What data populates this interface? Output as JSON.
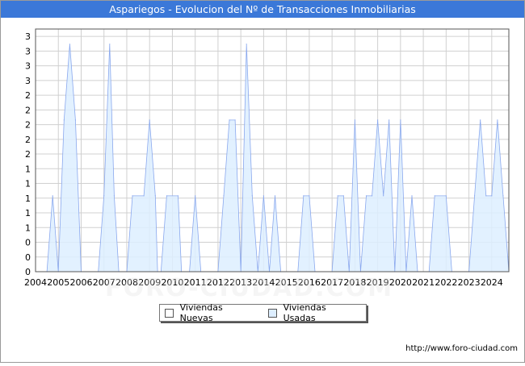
{
  "title": "Aspariegos - Evolucion del Nº de Transacciones Inmobiliarias",
  "url": "http://www.foro-ciudad.com",
  "watermark": "FORO-CIUDAD.COM",
  "legend": {
    "nuevas": "Viviendas Nuevas",
    "usadas": "Viviendas Usadas"
  },
  "colors": {
    "title_bg": "#3b78d8",
    "area_fill": "#ddeeff",
    "area_line": "#8aa8ee",
    "grid": "#d0d0d0"
  },
  "chart_data": {
    "type": "area",
    "title": "Aspariegos - Evolucion del Nº de Transacciones Inmobiliarias",
    "xlabel": "",
    "ylabel": "",
    "xlim": [
      2004,
      2024.75
    ],
    "ylim": [
      0,
      3.2
    ],
    "x_ticks": [
      "2004",
      "2005",
      "2006",
      "2007",
      "2008",
      "2009",
      "2010",
      "2011",
      "2012",
      "2013",
      "2014",
      "2015",
      "2016",
      "2017",
      "2018",
      "2019",
      "2020",
      "2021",
      "2022",
      "2023",
      "2024"
    ],
    "y_tick_labels": [
      "0",
      "0",
      "0",
      "1",
      "1",
      "1",
      "1",
      "1",
      "2",
      "2",
      "2",
      "2",
      "2",
      "3",
      "3",
      "3",
      "3"
    ],
    "grid": true,
    "legend_position": "bottom",
    "series": [
      {
        "name": "Viviendas Nuevas",
        "points": []
      },
      {
        "name": "Viviendas Usadas",
        "points": [
          [
            2004.5,
            0
          ],
          [
            2004.75,
            1
          ],
          [
            2004.9,
            0.4
          ],
          [
            2005.0,
            0
          ],
          [
            2005.25,
            2
          ],
          [
            2005.5,
            3
          ],
          [
            2005.75,
            2
          ],
          [
            2006.0,
            0
          ],
          [
            2006.75,
            0
          ],
          [
            2007.0,
            1
          ],
          [
            2007.25,
            3
          ],
          [
            2007.45,
            1
          ],
          [
            2007.65,
            0
          ],
          [
            2008.0,
            0
          ],
          [
            2008.25,
            1
          ],
          [
            2008.75,
            1
          ],
          [
            2009.0,
            2
          ],
          [
            2009.25,
            1
          ],
          [
            2009.35,
            0
          ],
          [
            2009.5,
            0
          ],
          [
            2009.75,
            1
          ],
          [
            2010.25,
            1
          ],
          [
            2010.4,
            0
          ],
          [
            2010.75,
            0
          ],
          [
            2011.0,
            1
          ],
          [
            2011.25,
            0
          ],
          [
            2012.0,
            0
          ],
          [
            2012.25,
            1
          ],
          [
            2012.5,
            2
          ],
          [
            2012.75,
            2
          ],
          [
            2013.0,
            0
          ],
          [
            2013.25,
            3
          ],
          [
            2013.5,
            1
          ],
          [
            2013.75,
            0
          ],
          [
            2014.0,
            1
          ],
          [
            2014.25,
            0
          ],
          [
            2014.5,
            1
          ],
          [
            2014.75,
            0
          ],
          [
            2015.5,
            0
          ],
          [
            2015.75,
            1
          ],
          [
            2016.0,
            1
          ],
          [
            2016.25,
            0
          ],
          [
            2017.0,
            0
          ],
          [
            2017.25,
            1
          ],
          [
            2017.5,
            1
          ],
          [
            2017.75,
            0
          ],
          [
            2018.0,
            2
          ],
          [
            2018.25,
            0
          ],
          [
            2018.5,
            1
          ],
          [
            2018.75,
            1
          ],
          [
            2019.0,
            2
          ],
          [
            2019.25,
            1
          ],
          [
            2019.5,
            2
          ],
          [
            2019.75,
            0
          ],
          [
            2020.0,
            2
          ],
          [
            2020.25,
            0
          ],
          [
            2020.5,
            1
          ],
          [
            2020.75,
            0
          ],
          [
            2021.25,
            0
          ],
          [
            2021.5,
            1
          ],
          [
            2022.0,
            1
          ],
          [
            2022.25,
            0
          ],
          [
            2023.0,
            0
          ],
          [
            2023.25,
            1
          ],
          [
            2023.5,
            2
          ],
          [
            2023.75,
            1
          ],
          [
            2024.0,
            1
          ],
          [
            2024.25,
            2
          ],
          [
            2024.5,
            1
          ],
          [
            2024.75,
            0
          ]
        ]
      }
    ]
  }
}
